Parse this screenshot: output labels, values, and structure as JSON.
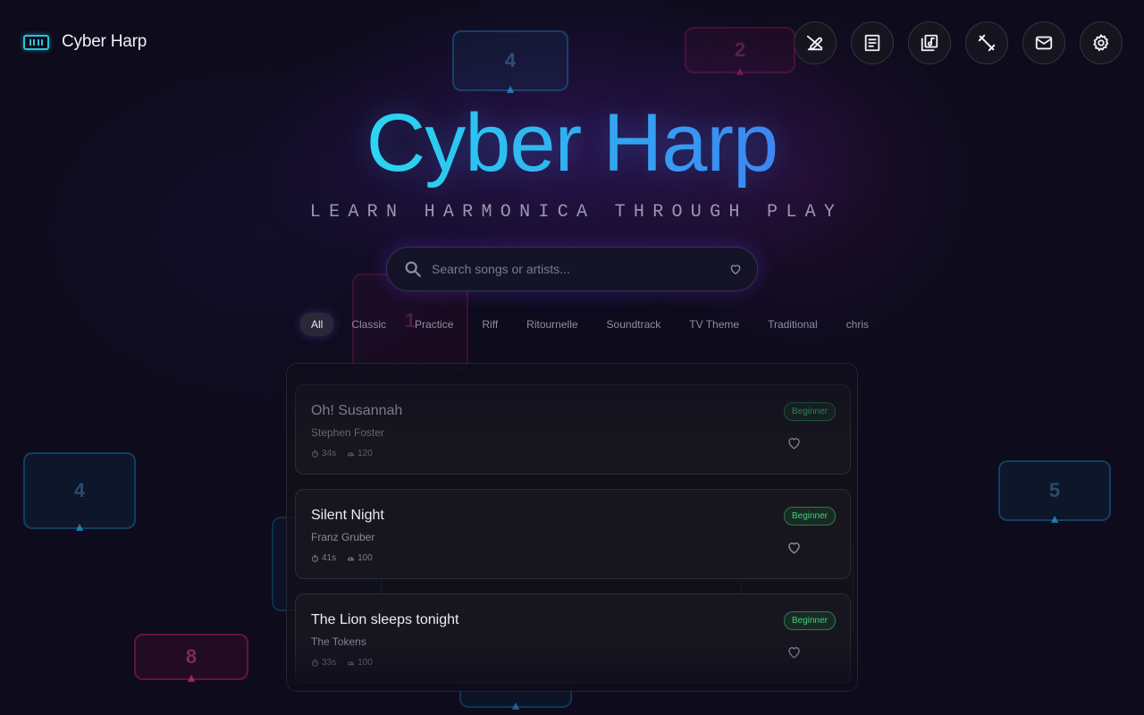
{
  "brand": {
    "name": "Cyber Harp"
  },
  "toolbar": {
    "buttons": [
      {
        "icon": "edit-off-icon",
        "label": "Edit"
      },
      {
        "icon": "notes-icon",
        "label": "Notes"
      },
      {
        "icon": "music-library-icon",
        "label": "Library"
      },
      {
        "icon": "fitness-icon",
        "label": "Practice"
      },
      {
        "icon": "mail-icon",
        "label": "Contact"
      },
      {
        "icon": "gear-icon",
        "label": "Settings"
      }
    ]
  },
  "hero": {
    "title": "Cyber Harp",
    "subtitle": "LEARN HARMONICA THROUGH PLAY"
  },
  "search": {
    "placeholder": "Search songs or artists...",
    "value": ""
  },
  "filters": {
    "items": [
      "All",
      "Classic",
      "Practice",
      "Riff",
      "Ritournelle",
      "Soundtrack",
      "TV Theme",
      "Traditional",
      "chris"
    ],
    "active": "All"
  },
  "songs": [
    {
      "title": "Oh! Susannah",
      "artist": "Stephen Foster",
      "duration": "34s",
      "tempo": "120",
      "level": "Beginner"
    },
    {
      "title": "Silent Night",
      "artist": "Franz Gruber",
      "duration": "41s",
      "tempo": "100",
      "level": "Beginner"
    },
    {
      "title": "The Lion sleeps tonight",
      "artist": "The Tokens",
      "duration": "33s",
      "tempo": "100",
      "level": "Beginner"
    }
  ],
  "background_notes": [
    {
      "label": "4",
      "color": "blue"
    },
    {
      "label": "2",
      "color": "pink"
    },
    {
      "label": "1",
      "color": "pink"
    },
    {
      "label": "4",
      "color": "blue"
    },
    {
      "label": "5",
      "color": "blue"
    },
    {
      "label": "8",
      "color": "pink"
    },
    {
      "label": "",
      "color": "blue"
    },
    {
      "label": "",
      "color": "pink"
    },
    {
      "label": "",
      "color": "blue"
    }
  ],
  "colors": {
    "accent_cyan": "#27c3dc",
    "accent_purple": "#7b3cf0",
    "badge_green": "#43d07a",
    "background": "#0d0b1c"
  }
}
